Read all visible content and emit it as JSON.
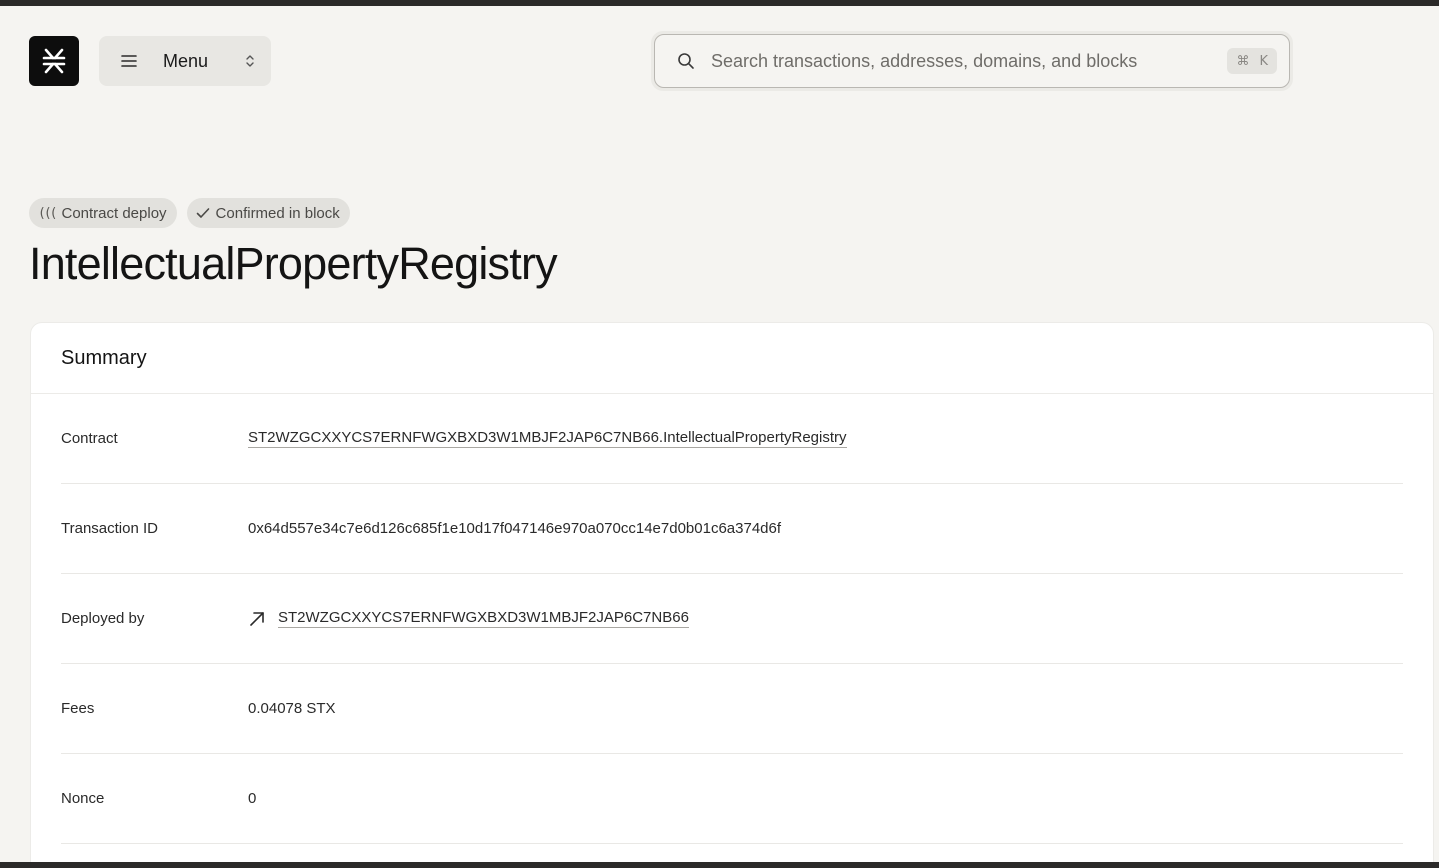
{
  "header": {
    "logo_icon": "stacks-logo-icon",
    "menu_label": "Menu",
    "search_placeholder": "Search transactions, addresses, domains, and blocks",
    "shortcut_modifier": "⌘",
    "shortcut_key": "K"
  },
  "badges": [
    {
      "icon": "contract-icon",
      "label": "Contract deploy"
    },
    {
      "icon": "check-icon",
      "label": "Confirmed in block"
    }
  ],
  "title": "IntellectualPropertyRegistry",
  "summary": {
    "heading": "Summary",
    "rows": [
      {
        "key": "Contract",
        "value": "ST2WZGCXXYCS7ERNFWGXBXD3W1MBJF2JAP6C7NB66.IntellectualPropertyRegistry"
      },
      {
        "key": "Transaction ID",
        "value": "0x64d557e34c7e6d126c685f1e10d17f047146e970a070cc14e7d0b01c6a374d6f"
      },
      {
        "key": "Deployed by",
        "value": "ST2WZGCXXYCS7ERNFWGXBXD3W1MBJF2JAP6C7NB66"
      },
      {
        "key": "Fees",
        "value": "0.04078 STX"
      },
      {
        "key": "Nonce",
        "value": "0"
      }
    ]
  }
}
